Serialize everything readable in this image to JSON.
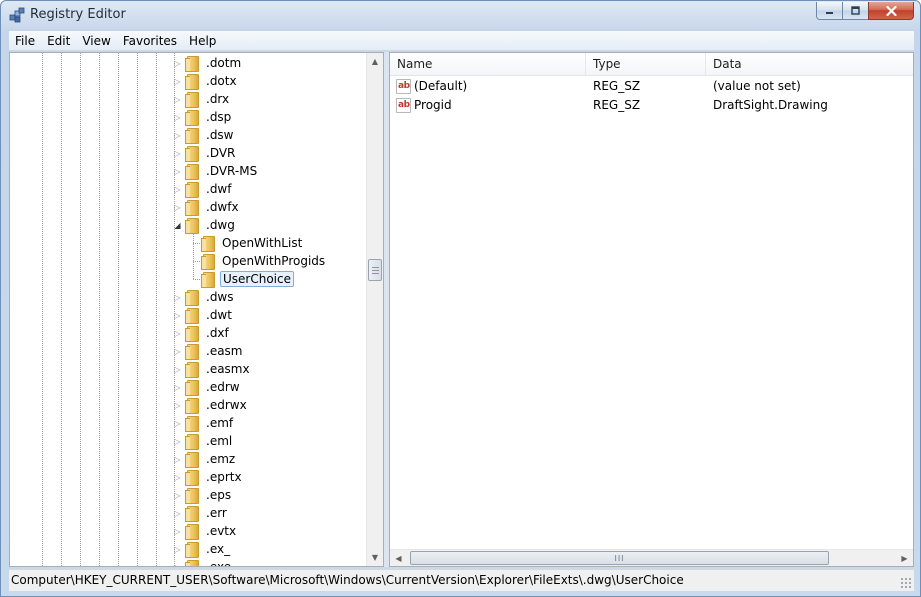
{
  "window": {
    "title": "Registry Editor",
    "accent": "#c6d6ea"
  },
  "menu": {
    "items": [
      "File",
      "Edit",
      "View",
      "Favorites",
      "Help"
    ]
  },
  "tree": {
    "items": [
      {
        "label": ".dotm",
        "expander": "collapsed"
      },
      {
        "label": ".dotx",
        "expander": "collapsed"
      },
      {
        "label": ".drx",
        "expander": "collapsed"
      },
      {
        "label": ".dsp",
        "expander": "collapsed"
      },
      {
        "label": ".dsw",
        "expander": "collapsed"
      },
      {
        "label": ".DVR",
        "expander": "collapsed"
      },
      {
        "label": ".DVR-MS",
        "expander": "collapsed"
      },
      {
        "label": ".dwf",
        "expander": "collapsed"
      },
      {
        "label": ".dwfx",
        "expander": "collapsed"
      },
      {
        "label": ".dwg",
        "expander": "expanded"
      },
      {
        "label": "OpenWithList",
        "expander": "none",
        "child": true
      },
      {
        "label": "OpenWithProgids",
        "expander": "none",
        "child": true
      },
      {
        "label": "UserChoice",
        "expander": "none",
        "child": true,
        "selected": true
      },
      {
        "label": ".dws",
        "expander": "collapsed"
      },
      {
        "label": ".dwt",
        "expander": "collapsed"
      },
      {
        "label": ".dxf",
        "expander": "collapsed"
      },
      {
        "label": ".easm",
        "expander": "collapsed"
      },
      {
        "label": ".easmx",
        "expander": "collapsed"
      },
      {
        "label": ".edrw",
        "expander": "collapsed"
      },
      {
        "label": ".edrwx",
        "expander": "collapsed"
      },
      {
        "label": ".emf",
        "expander": "collapsed"
      },
      {
        "label": ".eml",
        "expander": "collapsed"
      },
      {
        "label": ".emz",
        "expander": "collapsed"
      },
      {
        "label": ".eprtx",
        "expander": "collapsed"
      },
      {
        "label": ".eps",
        "expander": "collapsed"
      },
      {
        "label": ".err",
        "expander": "collapsed"
      },
      {
        "label": ".evtx",
        "expander": "collapsed"
      },
      {
        "label": ".ex_",
        "expander": "collapsed"
      },
      {
        "label": ".exe",
        "expander": "collapsed"
      }
    ],
    "scroll_position": 0.42
  },
  "list": {
    "columns": [
      "Name",
      "Type",
      "Data"
    ],
    "rows": [
      {
        "name": "(Default)",
        "type": "REG_SZ",
        "data": "(value not set)",
        "icon": "string-value-icon"
      },
      {
        "name": "Progid",
        "type": "REG_SZ",
        "data": "DraftSight.Drawing",
        "icon": "string-value-icon"
      }
    ],
    "hscroll_grip": "III"
  },
  "status": {
    "path": "Computer\\HKEY_CURRENT_USER\\Software\\Microsoft\\Windows\\CurrentVersion\\Explorer\\FileExts\\.dwg\\UserChoice"
  },
  "icons": {
    "app": "registry-icon",
    "value": "ab-string-icon",
    "folder": "folder-icon"
  }
}
